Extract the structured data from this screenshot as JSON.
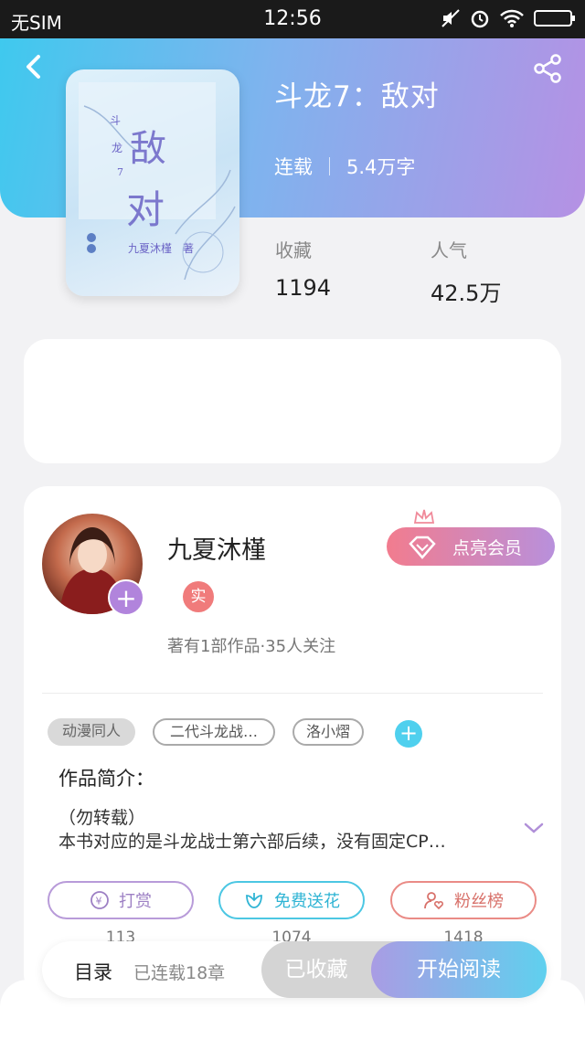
{
  "status": {
    "carrier": "无SIM",
    "time": "12:56"
  },
  "book": {
    "title": "斗龙7：敌对",
    "status": "连载",
    "words": "5.4万字",
    "favorites_label": "收藏",
    "favorites": "1194",
    "popularity_label": "人气",
    "popularity": "42.5万"
  },
  "author": {
    "name": "九夏沐槿",
    "badge": "实",
    "summary": "著有1部作品·35人关注",
    "vip_label": "点亮会员"
  },
  "tags": [
    "动漫同人",
    "二代斗龙战…",
    "洛小熠"
  ],
  "intro": {
    "label": "作品简介：",
    "line1": "（勿转载）",
    "line2": "本书对应的是斗龙战士第六部后续，没有固定CP…"
  },
  "actions": [
    {
      "label": "打赏",
      "count": "113"
    },
    {
      "label": "免费送花",
      "count": "1074"
    },
    {
      "label": "粉丝榜",
      "count": "1418"
    }
  ],
  "bottom": {
    "toc": "目录",
    "chapters": "已连载18章",
    "favorited": "已收藏",
    "read": "开始阅读"
  }
}
